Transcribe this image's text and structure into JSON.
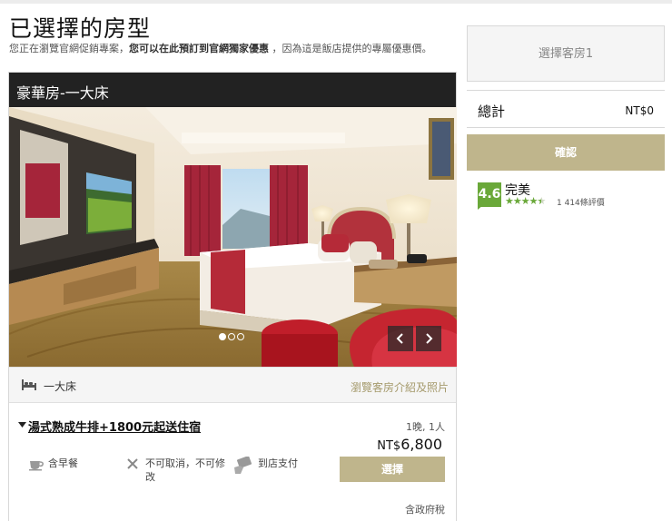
{
  "page": {
    "title": "已選擇的房型",
    "subtitle_pre": "您正在瀏覽官網促銷專案，",
    "subtitle_bold": "您可以在此預訂到官網獨家優惠",
    "subtitle_post": " ，因為這是飯店提供的專屬優惠價。"
  },
  "room": {
    "name": "豪華房-一大床",
    "bed": "一大床",
    "browse_link": "瀏覽客房介紹及照片",
    "carousel": {
      "slide_count": 3,
      "active_index": 0,
      "prev_icon": "chevron-left-icon",
      "next_icon": "chevron-right-icon"
    }
  },
  "rate": {
    "title": "湯式熟成牛排+1800元起送住宿",
    "occupancy": "1晚, 1人",
    "currency": "NT$",
    "amount": "6,800",
    "choose_label": "選擇",
    "features": [
      {
        "icon": "coffee-cup-icon",
        "label": "含早餐"
      },
      {
        "icon": "x-icon",
        "label": "不可取消，不可修改"
      },
      {
        "icon": "card-payment-icon",
        "label": "到店支付"
      }
    ],
    "tax_note": "含政府稅"
  },
  "sidebar": {
    "room_slot": "選擇客房1",
    "total_label": "總計",
    "total_value": "NT$0",
    "confirm_label": "確認"
  },
  "review": {
    "score": "4.6",
    "label": "完美",
    "stars": 4.5,
    "count": "1 414條評價"
  },
  "colors": {
    "accent": "#bfb58c",
    "link": "#a59a6c",
    "header_bg": "#222222",
    "review_green": "#6aa839"
  }
}
